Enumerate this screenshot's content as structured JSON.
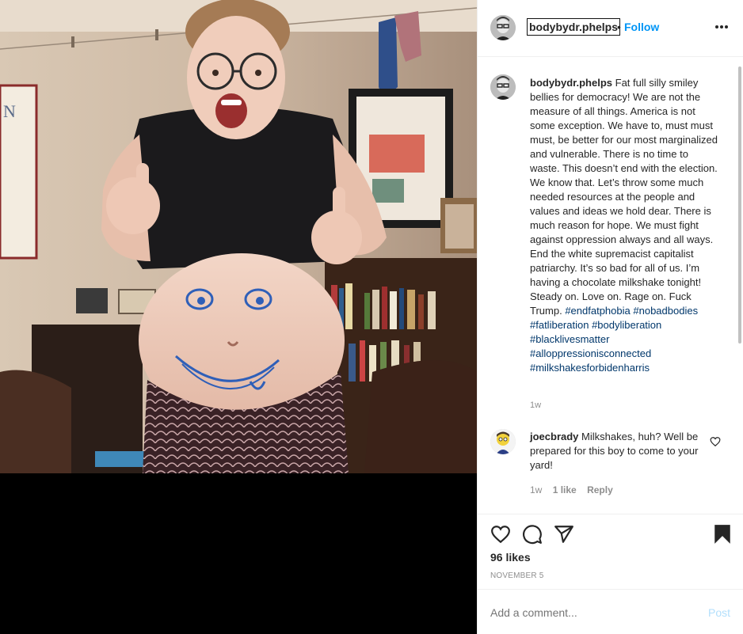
{
  "post": {
    "username": "bodybydr.phelps",
    "separator": "•",
    "follow_label": "Follow",
    "caption_text": "Fat full silly smiley bellies for democracy! We are not the measure of all things. America is not some exception. We have to, must must must, be better for our most marginalized and vulnerable. There is no time to waste. This doesn’t end with the election. We know that. Let’s throw some much needed resources at the people and values and ideas we hold dear. There is much reason for hope. We must fight against oppression always and all ways. End the white supremacist capitalist patriarchy. It’s so bad for all of us. I’m having a chocolate milkshake tonight! Steady on. Love on. Rage on. Fuck Trump.",
    "hashtags": [
      "#endfatphobia",
      "#nobadbodies",
      "#fatliberation",
      "#bodyliberation",
      "#blacklivesmatter",
      "#alloppressionisconnected",
      "#milkshakesforbidenharris"
    ],
    "caption_age": "1w",
    "likes": "96 likes",
    "date": "NOVEMBER 5"
  },
  "reply": {
    "username": "joecbrady",
    "text": "Milkshakes, huh? Well be prepared for this boy to come to your yard!",
    "age": "1w",
    "likes": "1 like",
    "reply_label": "Reply"
  },
  "composer": {
    "placeholder": "Add a comment...",
    "post_label": "Post"
  },
  "icons": {
    "more": "more-options-icon",
    "like": "heart-icon",
    "comment": "comment-icon",
    "share": "share-icon",
    "save": "bookmark-icon"
  }
}
